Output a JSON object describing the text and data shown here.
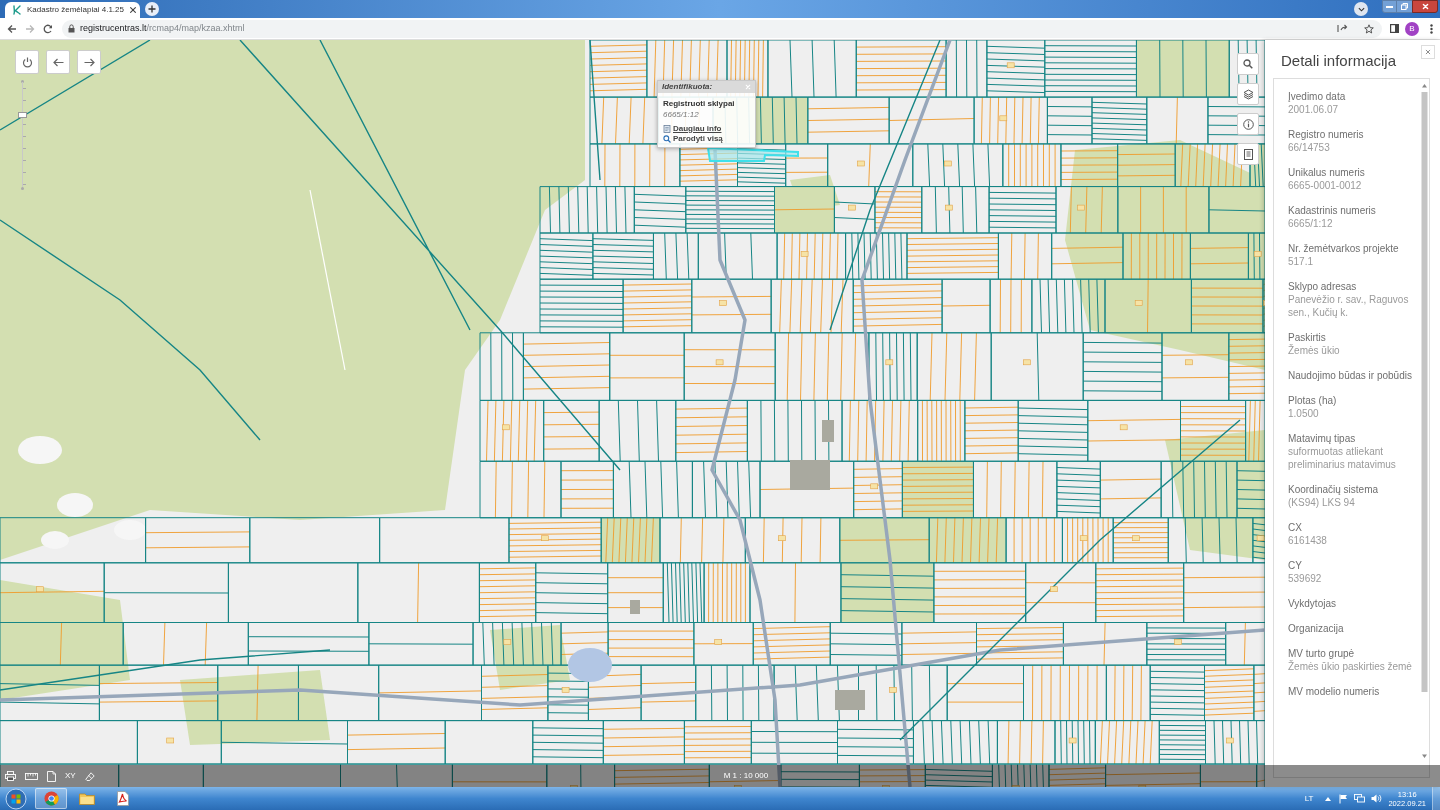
{
  "browser": {
    "tab_title": "Kadastro žemėlapiai 4.1.25",
    "url_host": "registrucentras.lt",
    "url_path": "/rcmap4/map/kzaa.xhtml",
    "forward_disabled": true,
    "profile_initial": "B"
  },
  "map": {
    "zoom_slider": {
      "level": 0.69
    },
    "popup": {
      "title": "Identifikuota:",
      "layer": "Registruoti sklypai",
      "parcel": "6665/1:12",
      "links": [
        {
          "kind": "info",
          "label": "Daugiau info"
        },
        {
          "kind": "zoom",
          "label": "Parodyti visą"
        }
      ]
    },
    "footer": {
      "coordinates_tool": "XY",
      "scale": "M 1 : 10 000"
    }
  },
  "detail_panel": {
    "title": "Detali informacija",
    "fields": [
      {
        "label": "Įvedimo data",
        "value": "2001.06.07"
      },
      {
        "label": "Registro numeris",
        "value": "66/14753"
      },
      {
        "label": "Unikalus numeris",
        "value": "6665-0001-0012"
      },
      {
        "label": "Kadastrinis numeris",
        "value": "6665/1:12"
      },
      {
        "label": "Nr. žemėtvarkos projekte",
        "value": "517.1"
      },
      {
        "label": "Sklypo adresas",
        "value": "Panevėžio r. sav., Raguvos sen., Kučių k."
      },
      {
        "label": "Paskirtis",
        "value": "Žemės ūkio"
      },
      {
        "label": "Naudojimo būdas ir pobūdis"
      },
      {
        "label": "Plotas (ha)",
        "value": "1.0500"
      },
      {
        "label": "Matavimų tipas",
        "value": "suformuotas atliekant preliminarius matavimus"
      },
      {
        "label": "Koordinačių sistema",
        "value": "(KS94) LKS 94"
      },
      {
        "label": "CX",
        "value": "6161438"
      },
      {
        "label": "CY",
        "value": "539692"
      },
      {
        "label": "Vykdytojas"
      },
      {
        "label": "Organizacija"
      },
      {
        "label": "MV turto grupė",
        "value": "Žemės ūkio paskirties žemė"
      },
      {
        "label": "MV modelio numeris"
      }
    ]
  },
  "taskbar": {
    "language": "LT",
    "time": "13:16",
    "date": "2022.09.21"
  }
}
